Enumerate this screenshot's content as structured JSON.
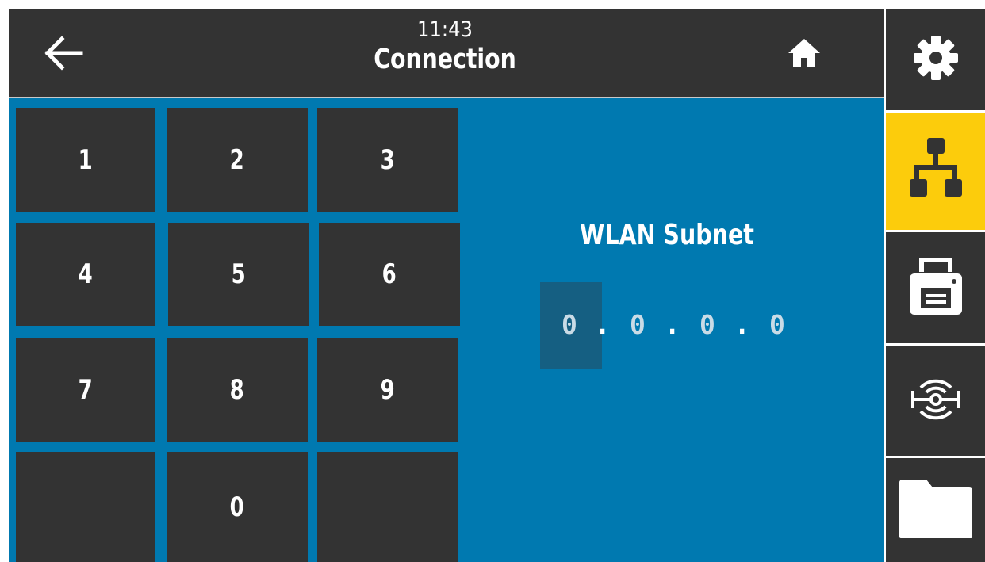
{
  "header": {
    "time": "11:43",
    "title": "Connection",
    "back_icon": "back-arrow-icon",
    "home_icon": "home-icon"
  },
  "keypad": {
    "keys": [
      {
        "label": "1"
      },
      {
        "label": "2"
      },
      {
        "label": "3"
      },
      {
        "label": "4"
      },
      {
        "label": "5"
      },
      {
        "label": "6"
      },
      {
        "label": "7"
      },
      {
        "label": "8"
      },
      {
        "label": "9"
      },
      {
        "label": ""
      },
      {
        "label": "0"
      },
      {
        "label": ""
      }
    ]
  },
  "field": {
    "label": "WLAN Subnet",
    "octets": [
      "0",
      "0",
      "0",
      "0"
    ],
    "separator": ".",
    "active_octet": 1
  },
  "sidebar": {
    "items": [
      {
        "icon": "settings-gear-icon",
        "active": false
      },
      {
        "icon": "network-connection-icon",
        "active": true
      },
      {
        "icon": "printer-icon",
        "active": false
      },
      {
        "icon": "rfid-sensor-icon",
        "active": false
      },
      {
        "icon": "folder-icon",
        "active": false
      }
    ]
  },
  "colors": {
    "panel": "#0079b0",
    "dark": "#333333",
    "accent": "#fccc0c",
    "white": "#ffffff"
  }
}
